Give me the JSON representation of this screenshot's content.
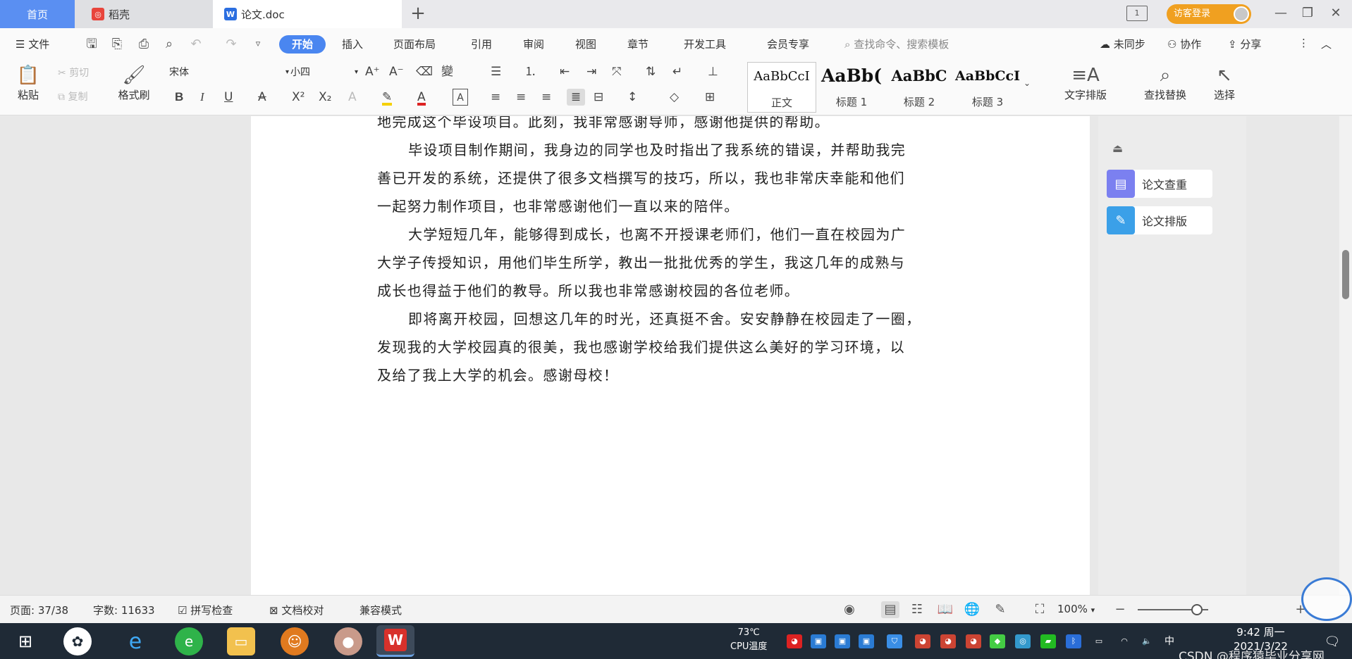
{
  "tabs": [
    {
      "label": "首页"
    },
    {
      "label": "稻壳"
    },
    {
      "label": "论文.doc"
    }
  ],
  "window": {
    "login_label": "访客登录"
  },
  "menu": {
    "file": "文件",
    "items": [
      "开始",
      "插入",
      "页面布局",
      "引用",
      "审阅",
      "视图",
      "章节",
      "开发工具",
      "会员专享"
    ],
    "search_placeholder": "查找命令、搜索模板",
    "sync": "未同步",
    "collab": "协作",
    "share": "分享"
  },
  "ribbon": {
    "paste": "粘贴",
    "cut": "剪切",
    "copy": "复制",
    "format_painter": "格式刷",
    "font_name": "宋体",
    "font_size": "小四",
    "styles": [
      {
        "preview": "AaBbCcI",
        "name": "正文"
      },
      {
        "preview": "AaBb(",
        "name": "标题 1"
      },
      {
        "preview": "AaBbC",
        "name": "标题 2"
      },
      {
        "preview": "AaBbCcI",
        "name": "标题 3"
      }
    ],
    "text_layout": "文字排版",
    "find_replace": "查找替换",
    "select": "选择"
  },
  "document": {
    "paragraphs": [
      {
        "lines": [
          "地完成这个毕设项目。此刻，我非常感谢导师，感谢他提供的帮助。"
        ]
      },
      {
        "lines": [
          "毕设项目制作期间，我身边的同学也及时指出了我系统的错误，并帮助我完",
          "善已开发的系统，还提供了很多文档撰写的技巧，所以，我也非常庆幸能和他们",
          "一起努力制作项目，也非常感谢他们一直以来的陪伴。"
        ]
      },
      {
        "lines": [
          "大学短短几年，能够得到成长，也离不开授课老师们，他们一直在校园为广",
          "大学子传授知识，用他们毕生所学，教出一批批优秀的学生，我这几年的成熟与",
          "成长也得益于他们的教导。所以我也非常感谢校园的各位老师。"
        ]
      },
      {
        "lines": [
          "即将离开校园，回想这几年的时光，还真挺不舍。安安静静在校园走了一圈，",
          "发现我的大学校园真的很美，我也感谢学校给我们提供这么美好的学习环境，以",
          "及给了我上大学的机会。感谢母校！"
        ]
      }
    ]
  },
  "sidepanel": {
    "check": "论文查重",
    "format": "论文排版"
  },
  "status": {
    "page": "页面: 37/38",
    "words": "字数: 11633",
    "spell": "拼写检查",
    "proof": "文档校对",
    "compat": "兼容模式",
    "zoom": "100%",
    "zoom_fraction": 0.84
  },
  "taskbar": {
    "cpu_value": "73℃",
    "cpu_label": "CPU温度",
    "time": "9:42 周一",
    "date": "2021/3/22",
    "watermark": "CSDN @程序猿毕业分享网"
  }
}
